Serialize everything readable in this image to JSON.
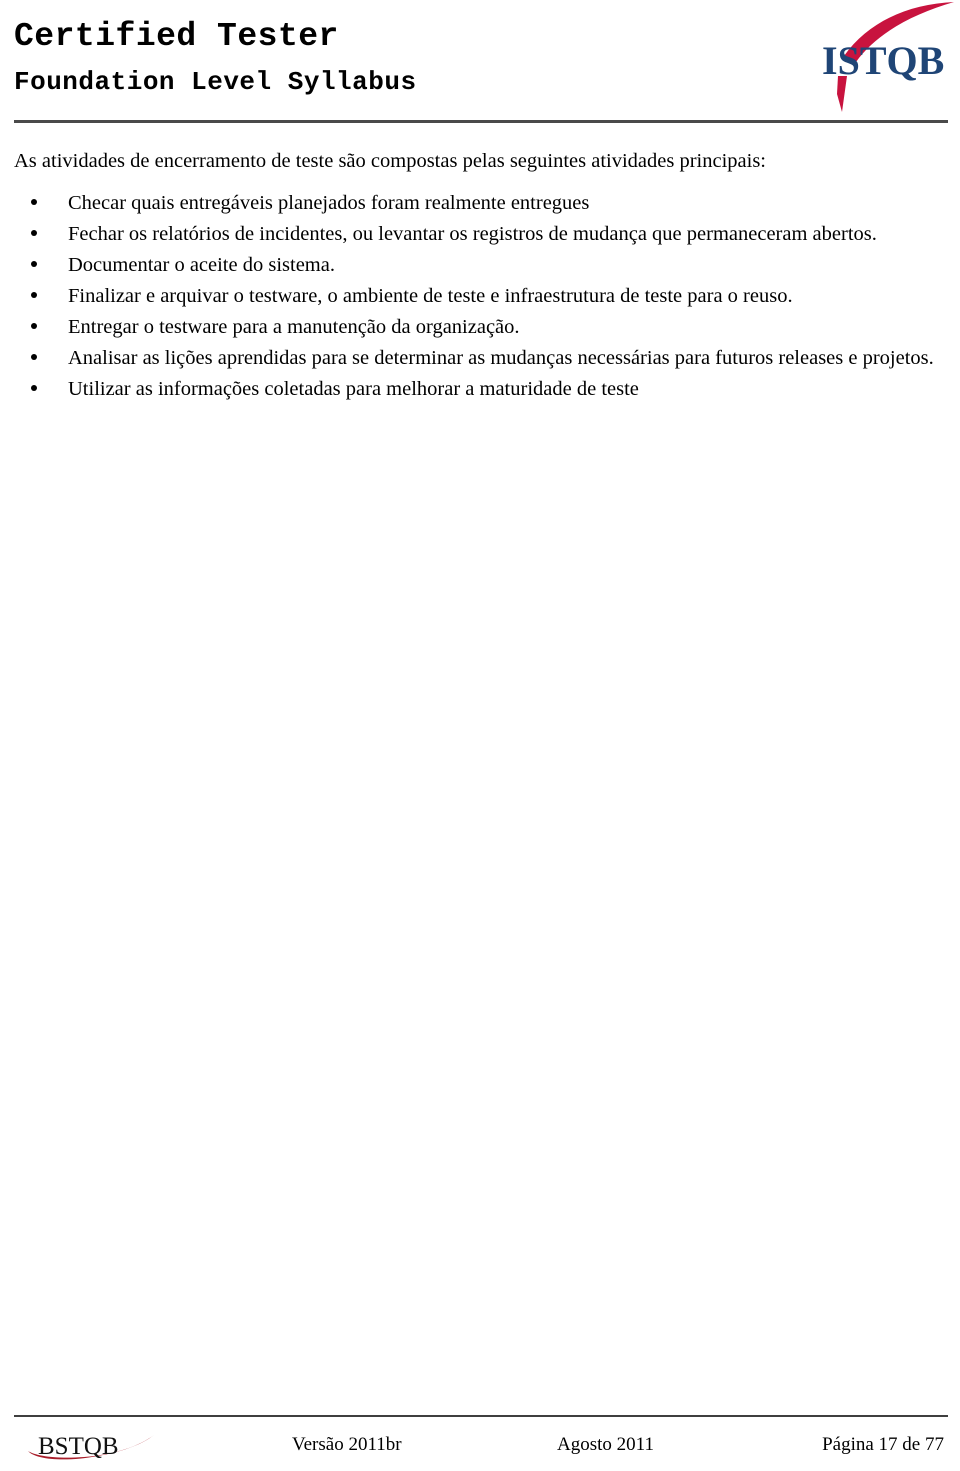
{
  "header": {
    "title_main": "Certified Tester",
    "title_sub": "Foundation Level Syllabus",
    "logo_name": "istqb-logo",
    "logo_text": "ISTQB",
    "logo_text_color": "#1F4576",
    "logo_swoosh_color": "#C8133E"
  },
  "content": {
    "intro": "As atividades de encerramento de teste são compostas pelas seguintes atividades principais:",
    "bullets": [
      "Checar quais entregáveis planejados foram realmente entregues",
      "Fechar os relatórios de incidentes, ou levantar os registros de mudança que permaneceram abertos.",
      "Documentar o aceite do sistema.",
      "Finalizar e arquivar o testware, o ambiente de teste e infraestrutura de teste para o reuso.",
      "Entregar o testware para a manutenção da organização.",
      "Analisar as lições aprendidas para se determinar as mudanças necessárias para futuros releases e projetos.",
      "Utilizar as informações coletadas para melhorar a maturidade de teste"
    ]
  },
  "footer": {
    "logo_name": "bstqb-logo",
    "logo_text": "BSTQB",
    "logo_swoosh_color": "#A81D2A",
    "version": "Versão 2011br",
    "date": "Agosto 2011",
    "page": "Página 17 de 77"
  }
}
